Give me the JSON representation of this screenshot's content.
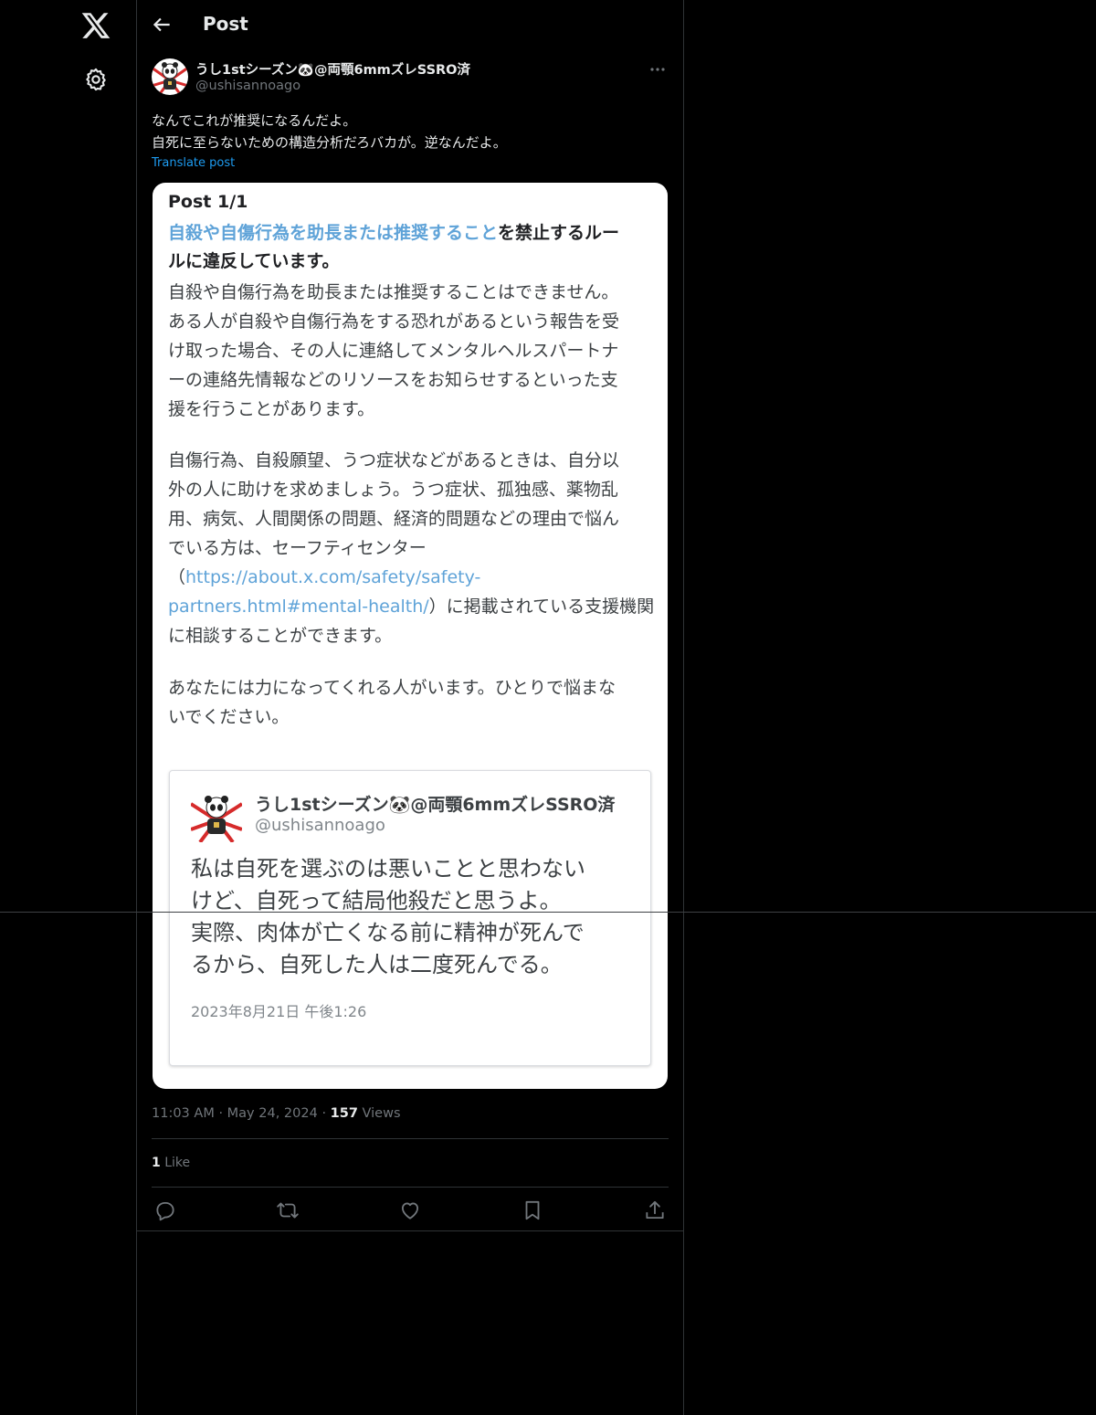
{
  "header": {
    "title": "Post"
  },
  "author": {
    "name": "うし1stシーズン🐼@両顎6mmズレSSRO済",
    "handle": "@ushisannoago"
  },
  "post": {
    "lines": [
      "なんでこれが推奨になるんだよ。",
      "自死に至らないための構造分析だろバカが。逆なんだよ。"
    ],
    "translate_label": "Translate post"
  },
  "media": {
    "heading": "Post 1/1",
    "rule_link": "自殺や自傷行為を助長または推奨すること",
    "rule_rest_line1": "を禁止するルー",
    "rule_line2": "ルに違反しています。",
    "para1": [
      "自殺や自傷行為を助長または推奨することはできません。",
      "ある人が自殺や自傷行為をする恐れがあるという報告を受",
      "け取った場合、その人に連絡してメンタルヘルスパートナ",
      "ーの連絡先情報などのリソースをお知らせするといった支",
      "援を行うことがあります。"
    ],
    "para2": [
      "自傷行為、自殺願望、うつ症状などがあるときは、自分以",
      "外の人に助けを求めましょう。うつ症状、孤独感、薬物乱",
      "用、病気、人間関係の問題、経済的問題などの理由で悩ん",
      "でいる方は、セーフティセンター"
    ],
    "para2_open": "（",
    "url_part1": "https://about.x.com/safety/safety-",
    "url_part2": "partners.html#mental-health/",
    "para2_after_url": "）に掲載されている支援機関",
    "para2_last": "に相談することができます。",
    "para3": [
      "あなたには力になってくれる人がいます。ひとりで悩まな",
      "いでください。"
    ],
    "quote": {
      "name": "うし1stシーズン🐼@両顎6mmズレSSRO済",
      "handle": "@ushisannoago",
      "text": [
        "私は自死を選ぶのは悪いことと思わない",
        "けど、自死って結局他殺だと思うよ。",
        "実際、肉体が亡くなる前に精神が死んで",
        "るから、自死した人は二度死んでる。"
      ],
      "date": "2023年8月21日 午後1:26"
    }
  },
  "meta": {
    "time": "11:03 AM",
    "sep": "·",
    "date": "May 24, 2024",
    "views_count": "157",
    "views_label": "Views"
  },
  "likes": {
    "count": "1",
    "label": "Like"
  },
  "icons": [
    "x-logo-icon",
    "gear-icon",
    "back-arrow-icon",
    "more-icon",
    "reply-icon",
    "repost-icon",
    "like-icon",
    "bookmark-icon",
    "share-icon"
  ],
  "colors": {
    "background": "#000000",
    "link": "#1d9bf0",
    "border": "#2f3336",
    "muted": "#71767b"
  }
}
